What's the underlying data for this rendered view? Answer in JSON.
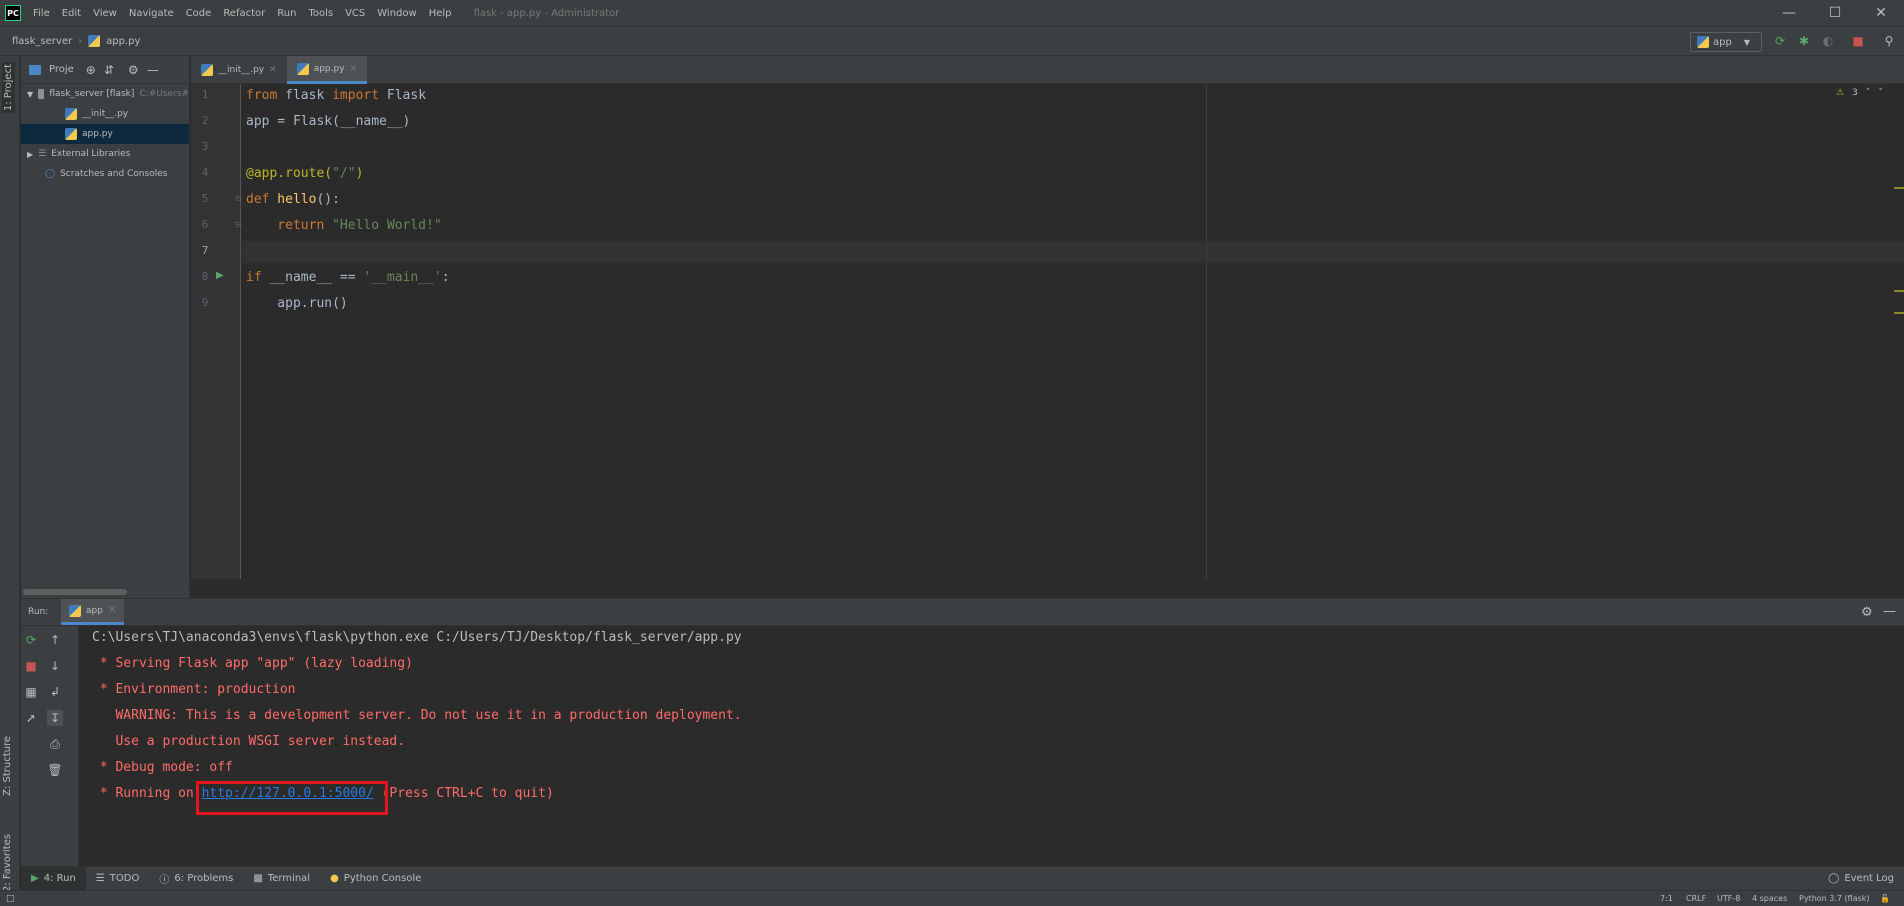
{
  "window": {
    "logo": "PC",
    "menu": [
      "File",
      "Edit",
      "View",
      "Navigate",
      "Code",
      "Refactor",
      "Run",
      "Tools",
      "VCS",
      "Window",
      "Help"
    ],
    "title": "flask - app.py - Administrator"
  },
  "navbar": {
    "breadcrumb": [
      "flask_server",
      "app.py"
    ],
    "run_config": "app"
  },
  "left_stripe": {
    "project_tab": "1: Project",
    "structure_tab": "Z: Structure",
    "favorites_tab": "2: Favorites"
  },
  "project": {
    "header_label": "Proje",
    "items": [
      {
        "label": "flask_server [flask]",
        "path": "C:#Users#"
      },
      {
        "label": "__init__.py"
      },
      {
        "label": "app.py"
      },
      {
        "label": "External Libraries"
      },
      {
        "label": "Scratches and Consoles"
      }
    ]
  },
  "editor": {
    "tabs": [
      "__init__.py",
      "app.py"
    ],
    "active_tab": "app.py",
    "warnings": "3",
    "line_numbers": [
      "1",
      "2",
      "3",
      "4",
      "5",
      "6",
      "7",
      "8",
      "9"
    ],
    "lines": {
      "l1_a": "from",
      "l1_b": " flask ",
      "l1_c": "import",
      "l1_d": " Flask",
      "l2": "app = Flask(__name__)",
      "l4_a": "@app.route(",
      "l4_b": "\"/\"",
      "l4_c": ")",
      "l5_a": "def",
      "l5_b": " hello",
      "l5_c": "():",
      "l6_a": "    return ",
      "l6_b": "\"Hello World!\"",
      "l8_a": "if",
      "l8_b": " __name__ == ",
      "l8_c": "'__main__'",
      "l8_d": ":",
      "l9": "    app.run()"
    }
  },
  "run_panel": {
    "label": "Run:",
    "tab": "app",
    "output": [
      "C:\\Users\\TJ\\anaconda3\\envs\\flask\\python.exe C:/Users/TJ/Desktop/flask_server/app.py",
      " * Serving Flask app \"app\" (lazy loading)",
      " * Environment: production",
      "   WARNING: This is a development server. Do not use it in a production deployment.",
      "   Use a production WSGI server instead.",
      " * Debug mode: off"
    ],
    "running_prefix": " * Running on ",
    "running_link": "http://127.0.0.1:5000/",
    "running_suffix": " (Press CTRL+C to quit)"
  },
  "bottom_tabs": {
    "run": "4: Run",
    "todo": "TODO",
    "problems": "6: Problems",
    "terminal": "Terminal",
    "python_console": "Python Console",
    "event_log": "Event Log"
  },
  "status": {
    "position": "7:1",
    "line_sep": "CRLF",
    "encoding": "UTF-8",
    "indent": "4 spaces",
    "interpreter": "Python 3.7 (flask)"
  },
  "colors": {
    "accent": "#4a88c7",
    "highlight_box": "#e4151b",
    "error_text": "#ff6b68",
    "link": "#287bde"
  }
}
